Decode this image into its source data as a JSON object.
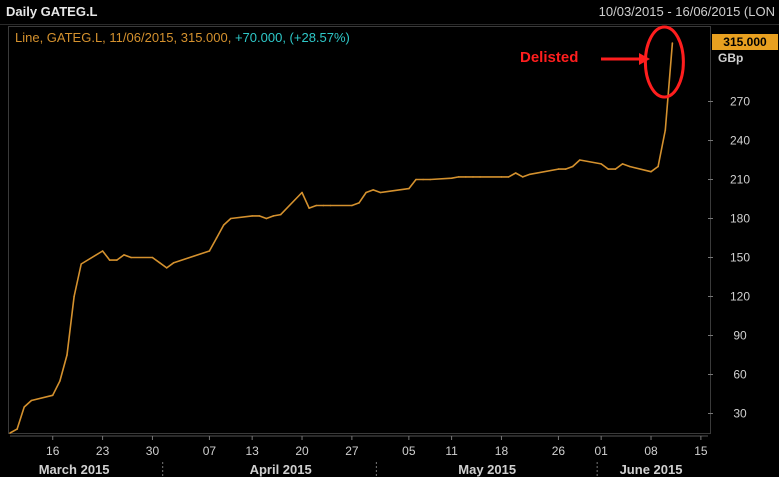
{
  "header": {
    "title": "Daily GATEG.L",
    "date_range": "10/03/2015 - 16/06/2015 (LON"
  },
  "legend": {
    "series_label": "Line, GATEG.L, 11/06/2015, 315.000,",
    "change_label": "+70.000, (+28.57%)"
  },
  "axis": {
    "unit": "GBp",
    "last_value": "315.000"
  },
  "annotation": {
    "label": "Delisted"
  },
  "colors": {
    "series": "#d4912e",
    "change": "#2ec8c8",
    "last_tag": "#e8a020",
    "annotation": "#ff1e1e",
    "axis_text": "#d0d0d0"
  },
  "chart_data": {
    "type": "line",
    "series": [
      {
        "name": "Line, GATEG.L",
        "points": [
          [
            "2015-03-10",
            15
          ],
          [
            "2015-03-11",
            18
          ],
          [
            "2015-03-12",
            35
          ],
          [
            "2015-03-13",
            40
          ],
          [
            "2015-03-16",
            44
          ],
          [
            "2015-03-17",
            55
          ],
          [
            "2015-03-18",
            75
          ],
          [
            "2015-03-19",
            120
          ],
          [
            "2015-03-20",
            145
          ],
          [
            "2015-03-23",
            155
          ],
          [
            "2015-03-24",
            148
          ],
          [
            "2015-03-25",
            148
          ],
          [
            "2015-03-26",
            152
          ],
          [
            "2015-03-27",
            150
          ],
          [
            "2015-03-30",
            150
          ],
          [
            "2015-03-31",
            146
          ],
          [
            "2015-04-01",
            142
          ],
          [
            "2015-04-02",
            146
          ],
          [
            "2015-04-07",
            155
          ],
          [
            "2015-04-08",
            165
          ],
          [
            "2015-04-09",
            175
          ],
          [
            "2015-04-10",
            180
          ],
          [
            "2015-04-13",
            182
          ],
          [
            "2015-04-14",
            182
          ],
          [
            "2015-04-15",
            180
          ],
          [
            "2015-04-16",
            182
          ],
          [
            "2015-04-17",
            183
          ],
          [
            "2015-04-20",
            200
          ],
          [
            "2015-04-21",
            188
          ],
          [
            "2015-04-22",
            190
          ],
          [
            "2015-04-23",
            190
          ],
          [
            "2015-04-24",
            190
          ],
          [
            "2015-04-27",
            190
          ],
          [
            "2015-04-28",
            192
          ],
          [
            "2015-04-29",
            200
          ],
          [
            "2015-04-30",
            202
          ],
          [
            "2015-05-01",
            200
          ],
          [
            "2015-05-05",
            203
          ],
          [
            "2015-05-06",
            210
          ],
          [
            "2015-05-07",
            210
          ],
          [
            "2015-05-08",
            210
          ],
          [
            "2015-05-11",
            211
          ],
          [
            "2015-05-12",
            212
          ],
          [
            "2015-05-13",
            212
          ],
          [
            "2015-05-14",
            212
          ],
          [
            "2015-05-15",
            212
          ],
          [
            "2015-05-18",
            212
          ],
          [
            "2015-05-19",
            212
          ],
          [
            "2015-05-20",
            215
          ],
          [
            "2015-05-21",
            212
          ],
          [
            "2015-05-22",
            214
          ],
          [
            "2015-05-26",
            218
          ],
          [
            "2015-05-27",
            218
          ],
          [
            "2015-05-28",
            220
          ],
          [
            "2015-05-29",
            225
          ],
          [
            "2015-06-01",
            222
          ],
          [
            "2015-06-02",
            218
          ],
          [
            "2015-06-03",
            218
          ],
          [
            "2015-06-04",
            222
          ],
          [
            "2015-06-05",
            220
          ],
          [
            "2015-06-08",
            216
          ],
          [
            "2015-06-09",
            220
          ],
          [
            "2015-06-10",
            248
          ],
          [
            "2015-06-11",
            315
          ]
        ]
      }
    ],
    "xlim": [
      "2015-03-10",
      "2015-06-16"
    ],
    "ylim": [
      15,
      325
    ],
    "y_ticks": [
      30,
      60,
      90,
      120,
      150,
      180,
      210,
      240,
      270
    ],
    "x_ticks": [
      {
        "date": "2015-03-16",
        "label": "16"
      },
      {
        "date": "2015-03-23",
        "label": "23"
      },
      {
        "date": "2015-03-30",
        "label": "30"
      },
      {
        "date": "2015-04-07",
        "label": "07"
      },
      {
        "date": "2015-04-13",
        "label": "13"
      },
      {
        "date": "2015-04-20",
        "label": "20"
      },
      {
        "date": "2015-04-27",
        "label": "27"
      },
      {
        "date": "2015-05-05",
        "label": "05"
      },
      {
        "date": "2015-05-11",
        "label": "11"
      },
      {
        "date": "2015-05-18",
        "label": "18"
      },
      {
        "date": "2015-05-26",
        "label": "26"
      },
      {
        "date": "2015-06-01",
        "label": "01"
      },
      {
        "date": "2015-06-08",
        "label": "08"
      },
      {
        "date": "2015-06-15",
        "label": "15"
      }
    ],
    "month_labels": [
      {
        "date": "2015-03-19",
        "label": "March 2015"
      },
      {
        "date": "2015-04-17",
        "label": "April 2015"
      },
      {
        "date": "2015-05-16",
        "label": "May 2015"
      },
      {
        "date": "2015-06-08",
        "label": "June 2015"
      }
    ],
    "month_boundaries": [
      "2015-04-01",
      "2015-05-01",
      "2015-06-01"
    ],
    "grid": false
  }
}
